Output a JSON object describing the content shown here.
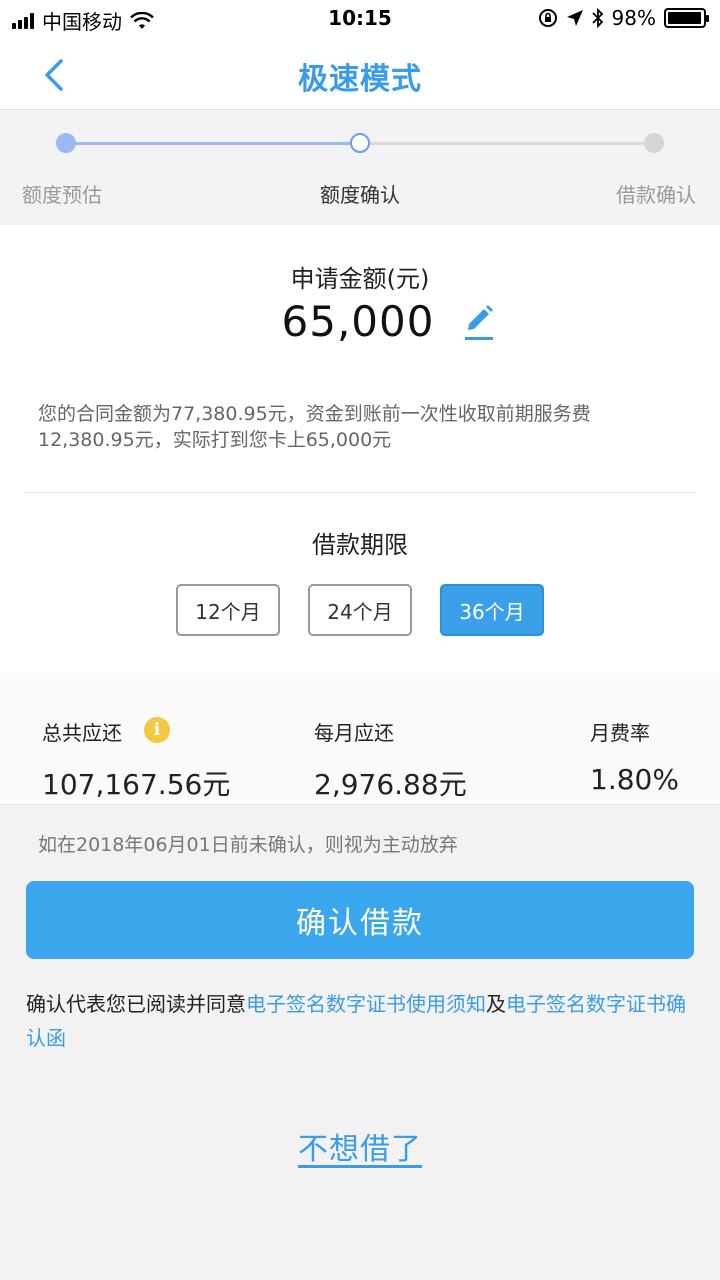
{
  "status_bar": {
    "carrier": "中国移动",
    "time": "10:15",
    "battery_percent": "98%",
    "battery_level": 0.98
  },
  "nav": {
    "title": "极速模式",
    "back_icon": "chevron-left-icon"
  },
  "colors": {
    "accent": "#3a9ce8",
    "button_blue": "#3aa7ec",
    "step_done": "#9cb8f0",
    "info_yellow": "#f5c842"
  },
  "steps": [
    {
      "label": "额度预估",
      "state": "done"
    },
    {
      "label": "额度确认",
      "state": "current"
    },
    {
      "label": "借款确认",
      "state": "todo"
    }
  ],
  "application": {
    "amount_title": "申请金额(元)",
    "amount_value": "65,000",
    "edit_icon": "pencil-icon",
    "contract_note": "您的合同金额为77,380.95元，资金到账前一次性收取前期服务费12,380.95元，实际打到您卡上65,000元"
  },
  "term": {
    "title": "借款期限",
    "options": [
      "12个月",
      "24个月",
      "36个月"
    ],
    "selected": "36个月"
  },
  "summary": {
    "total_label": "总共应还",
    "total_value": "107,167.56元",
    "info_icon": "i",
    "monthly_label": "每月应还",
    "monthly_value": "2,976.88元",
    "rate_label": "月费率",
    "rate_value": "1.80%"
  },
  "deadline_note": "如在2018年06月01日前未确认，则视为主动放弃",
  "confirm_button": "确认借款",
  "agreement": {
    "prefix": "确认代表您已阅读并同意",
    "link1": "电子签名数字证书使用须知",
    "connector": "及",
    "link2": "电子签名数字证书确认函"
  },
  "cancel_link": "不想借了"
}
